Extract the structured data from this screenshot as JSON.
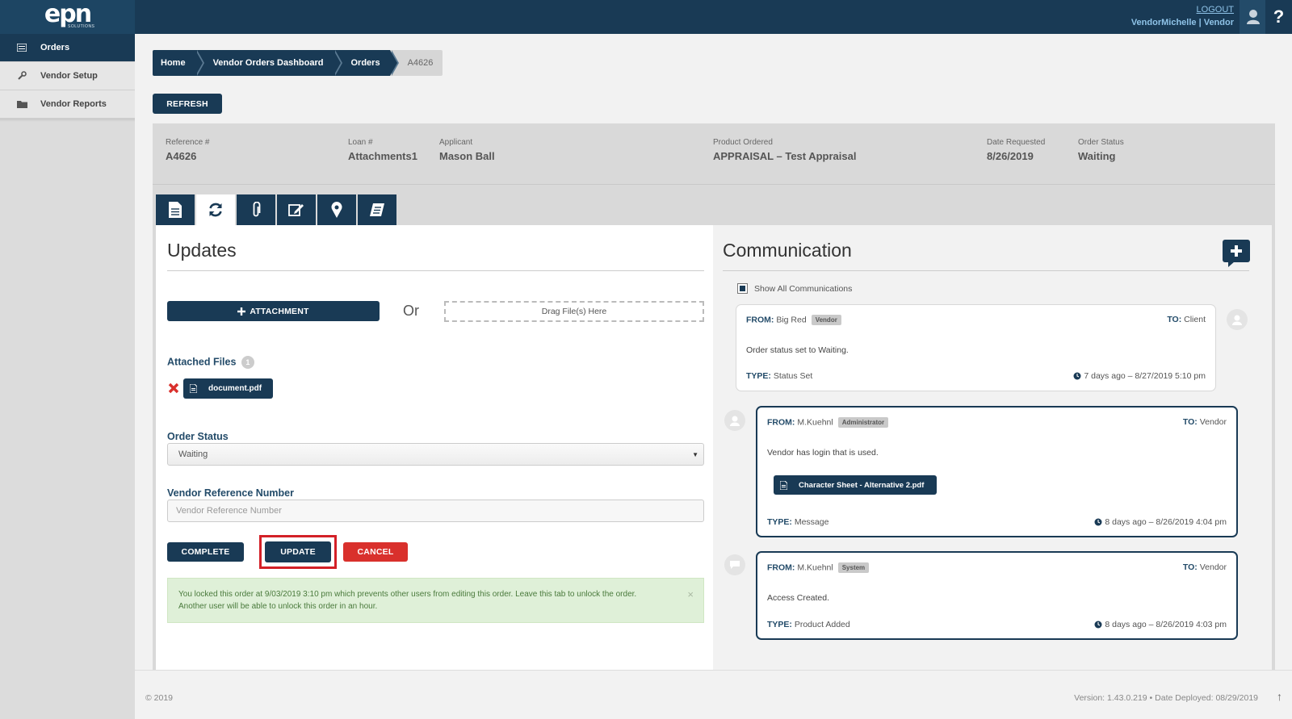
{
  "header": {
    "logo_text": "epn",
    "logo_subtext": "SOLUTIONS",
    "logout_label": "LOGOUT",
    "user_line": "VendorMichelle | Vendor",
    "help_glyph": "?"
  },
  "sidebar": {
    "items": [
      {
        "label": "Orders",
        "icon": "list-icon",
        "active": true
      },
      {
        "label": "Vendor Setup",
        "icon": "wrench-icon",
        "active": false
      },
      {
        "label": "Vendor Reports",
        "icon": "folder-icon",
        "active": false
      }
    ]
  },
  "breadcrumb": [
    "Home",
    "Vendor Orders Dashboard",
    "Orders",
    "A4626"
  ],
  "refresh_label": "REFRESH",
  "order_info": {
    "reference": {
      "label": "Reference #",
      "value": "A4626"
    },
    "loan": {
      "label": "Loan #",
      "value": "Attachments1"
    },
    "applicant": {
      "label": "Applicant",
      "value": "Mason Ball"
    },
    "product": {
      "label": "Product Ordered",
      "value": "APPRAISAL – Test Appraisal"
    },
    "date_requested": {
      "label": "Date Requested",
      "value": "8/26/2019"
    },
    "status": {
      "label": "Order Status",
      "value": "Waiting"
    }
  },
  "tabs": [
    "document-icon",
    "refresh-icon",
    "paperclip-icon",
    "edit-icon",
    "map-pin-icon",
    "notebook-icon"
  ],
  "updates": {
    "title": "Updates",
    "attachment_label": "ATTACHMENT",
    "or_text": "Or",
    "drop_label": "Drag File(s) Here",
    "attached_files_label": "Attached Files",
    "attached_count": "1",
    "file_name": "document.pdf",
    "order_status_label": "Order Status",
    "order_status_value": "Waiting",
    "vendor_ref_label": "Vendor Reference Number",
    "vendor_ref_placeholder": "Vendor Reference Number",
    "complete_label": "COMPLETE",
    "update_label": "UPDATE",
    "cancel_label": "CANCEL",
    "alert_line1": "You locked this order at 9/03/2019 3:10 pm which prevents other users from editing this order. Leave this tab to unlock the order.",
    "alert_line2": "Another user will be able to unlock this order in an hour.",
    "alert_close": "×"
  },
  "communication": {
    "title": "Communication",
    "show_all_label": "Show All Communications",
    "from_label": "FROM:",
    "to_label": "TO:",
    "type_label": "TYPE:",
    "messages": [
      {
        "from": "Big Red",
        "role": "Vendor",
        "to": "Client",
        "body": "Order status set to Waiting.",
        "type": "Status Set",
        "time": "7 days ago – 8/27/2019 5:10 pm"
      },
      {
        "from": "M.Kuehnl",
        "role": "Administrator",
        "to": "Vendor",
        "body": "Vendor has login that is used.",
        "file": "Character Sheet - Alternative 2.pdf",
        "type": "Message",
        "time": "8 days ago – 8/26/2019 4:04 pm"
      },
      {
        "from": "M.Kuehnl",
        "role": "System",
        "to": "Vendor",
        "body": "Access Created.",
        "type": "Product Added",
        "time": "8 days ago – 8/26/2019 4:03 pm"
      }
    ]
  },
  "footer": {
    "copyright": "© 2019",
    "version": "Version: 1.43.0.219  •  Date Deployed: 08/29/2019"
  },
  "colors": {
    "navy": "#193a55",
    "danger": "#d9302c",
    "highlight": "#d32027",
    "success_bg": "#dff0d8"
  }
}
